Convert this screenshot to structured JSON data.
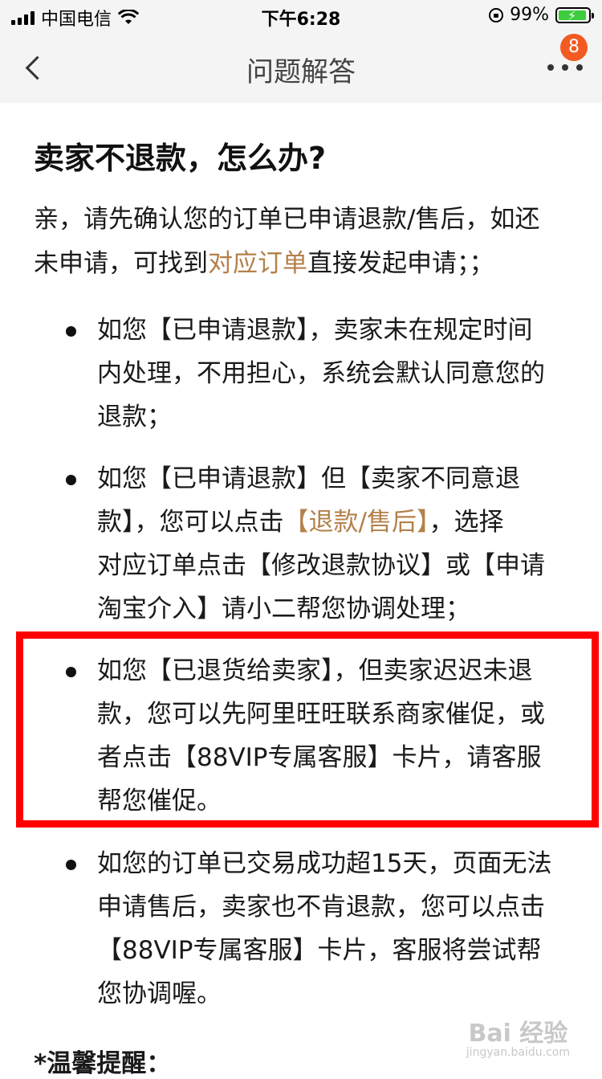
{
  "status_bar": {
    "carrier": "中国电信",
    "time": "下午6:28",
    "battery": "99%"
  },
  "nav": {
    "title": "问题解答",
    "badge_count": "8"
  },
  "article": {
    "heading": "卖家不退款，怎么办?",
    "intro": {
      "line1": "亲，请先确认您的订单已申请退款/售后，如还",
      "line2_pre": "未申请，可找到",
      "line2_link": "对应订单",
      "line2_post": "直接发起申请；；"
    },
    "bullets": [
      {
        "lines": [
          "如您【已申请退款】，卖家未在规定时间",
          "内处理，不用担心，系统会默认同意您的",
          "退款；"
        ]
      },
      {
        "line1": "如您【已申请退款】但【卖家不同意退",
        "line2_pre": "款】，您可以点击",
        "line2_link": "【退款/售后】",
        "line2_post": "，选择",
        "line3": "对应订单点击【修改退款协议】或【申请",
        "line4": "淘宝介入】请小二帮您协调处理；"
      },
      {
        "lines": [
          "如您【已退货给卖家】，但卖家迟迟未退",
          "款，您可以先阿里旺旺联系商家催促，或",
          "者点击【88VIP专属客服】卡片，请客服",
          "帮您催促。"
        ]
      },
      {
        "lines": [
          "如您的订单已交易成功超15天，页面无法",
          "申请售后，卖家也不肯退款，您可以点击",
          "【88VIP专属客服】卡片，客服将尝试帮",
          "您协调喔。"
        ]
      }
    ],
    "reminder": "*温馨提醒："
  },
  "watermark": {
    "brand": "Bai 经验",
    "url": "jingyan.baidu.com"
  },
  "colors": {
    "link": "#b4804a",
    "highlight": "#ff0000",
    "badge": "#f25a22"
  }
}
